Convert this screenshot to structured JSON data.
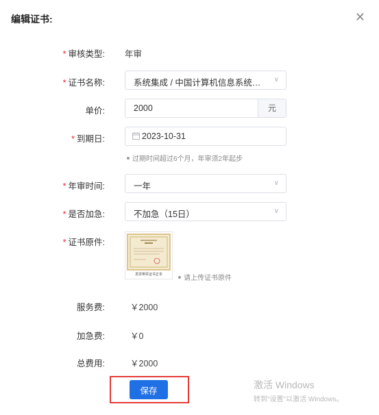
{
  "dialog": {
    "title": "编辑证书:"
  },
  "form": {
    "audit_type": {
      "label": "审核类型:",
      "value": "年审",
      "required": true
    },
    "cert_name": {
      "label": "证书名称:",
      "value": "系统集成 / 中国计算机信息系统集成行业协会",
      "required": true
    },
    "price": {
      "label": "单价:",
      "value": "2000",
      "suffix": "元"
    },
    "expiry": {
      "label": "到期日:",
      "value": "2023-10-31",
      "hint": "过期时间超过6个月，年审须2年起步",
      "required": true
    },
    "audit_period": {
      "label": "年审时间:",
      "value": "一年",
      "required": true
    },
    "urgent": {
      "label": "是否加急:",
      "value": "不加急（15日）",
      "required": true
    },
    "cert_file": {
      "label": "证书原件:",
      "thumb_caption": "发票带票证书正本",
      "upload_hint": "请上传证书原件",
      "required": true
    }
  },
  "fees": {
    "service_label": "服务费:",
    "service_value": "￥2000",
    "urgent_label": "加急费:",
    "urgent_value": "￥0",
    "total_label": "总费用:",
    "total_value": "￥2000"
  },
  "actions": {
    "save_label": "保存"
  },
  "watermark": {
    "line1": "激活 Windows",
    "line2": "转到\"设置\"以激活 Windows。"
  },
  "colors": {
    "primary": "#1f6fe5",
    "required": "#f5222d",
    "highlight": "#e53935"
  },
  "icons": {
    "close": "close-icon",
    "chevron": "chevron-down-icon",
    "calendar": "calendar-icon"
  }
}
